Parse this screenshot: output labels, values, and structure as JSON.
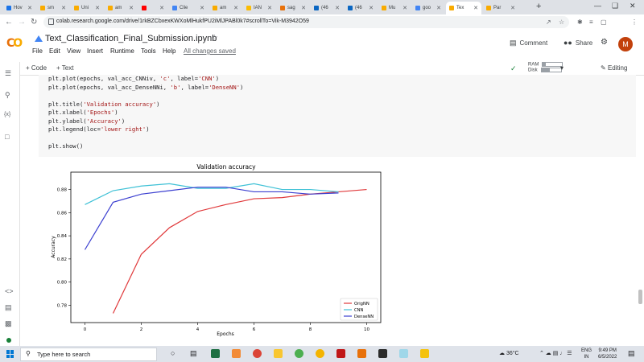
{
  "browser": {
    "tabs": [
      {
        "label": "Hov",
        "color": "#1a73e8"
      },
      {
        "label": "sm",
        "color": "#f9ab00"
      },
      {
        "label": "Uni",
        "color": "#f9ab00"
      },
      {
        "label": "am",
        "color": "#f9ab00"
      },
      {
        "label": "",
        "color": "#ff0000"
      },
      {
        "label": "Clie",
        "color": "#4285f4"
      },
      {
        "label": "am",
        "color": "#f9ab00"
      },
      {
        "label": "IAN",
        "color": "#fbbc04"
      },
      {
        "label": "sag",
        "color": "#e8710a"
      },
      {
        "label": "(46",
        "color": "#0a66c2"
      },
      {
        "label": "(46",
        "color": "#0a66c2"
      },
      {
        "label": "Mu",
        "color": "#f9ab00"
      },
      {
        "label": "goo",
        "color": "#4285f4"
      },
      {
        "label": "Tex",
        "color": "#f9ab00"
      },
      {
        "label": "Par",
        "color": "#f9ab00"
      }
    ],
    "url": "colab.research.google.com/drive/1rkBZCbxexKWXoMlHukfPU2iMlJPABl0k7#scrollTo=Vik-M3942O59"
  },
  "colab": {
    "logo": "CO",
    "title": "Text_Classification_Final_Submission.ipynb",
    "menus": [
      "File",
      "Edit",
      "View",
      "Insert",
      "Runtime",
      "Tools",
      "Help"
    ],
    "saved_status": "All changes saved",
    "comment_label": "Comment",
    "share_label": "Share",
    "avatar_letter": "M",
    "add_code": "+ Code",
    "add_text": "+ Text",
    "ram_label": "RAM",
    "disk_label": "Disk",
    "ram_usage": 0.15,
    "disk_usage": 0.45,
    "editing_label": "Editing"
  },
  "code_lines": [
    "plt.plot(epochs, val_acc_CNNiv, 'c', label='CNN')",
    "plt.plot(epochs, val_acc_DenseNNi, 'b', label='DenseNN')",
    "",
    "plt.title('Validation accuracy')",
    "plt.xlabel('Epochs')",
    "plt.ylabel('Accuracy')",
    "plt.legend(loc='lower right')",
    "",
    "plt.show()"
  ],
  "chart_data": {
    "type": "line",
    "title": "Validation accuracy",
    "xlabel": "Epochs",
    "ylabel": "Accuracy",
    "xlim": [
      -0.5,
      10.5
    ],
    "ylim": [
      0.765,
      0.895
    ],
    "xticks": [
      "0",
      "2",
      "4",
      "6",
      "8",
      "10"
    ],
    "xtick_values": [
      0,
      2,
      4,
      6,
      8,
      10
    ],
    "yticks": [
      "0.78",
      "0.80",
      "0.82",
      "0.84",
      "0.86",
      "0.88"
    ],
    "ytick_values": [
      0.78,
      0.8,
      0.82,
      0.84,
      0.86,
      0.88
    ],
    "legend_loc": "lower right",
    "grid": false,
    "series": [
      {
        "name": "OrigNN",
        "color": "#e0393b",
        "x": [
          1,
          2,
          3,
          4,
          5,
          6,
          7,
          8,
          9,
          10
        ],
        "y": [
          0.773,
          0.824,
          0.847,
          0.861,
          0.867,
          0.872,
          0.873,
          0.876,
          0.878,
          0.88
        ]
      },
      {
        "name": "CNN",
        "color": "#3fc1d6",
        "x": [
          0,
          1,
          2,
          3,
          4,
          5,
          6,
          7,
          8,
          9
        ],
        "y": [
          0.867,
          0.879,
          0.883,
          0.885,
          0.881,
          0.881,
          0.885,
          0.88,
          0.88,
          0.878
        ]
      },
      {
        "name": "DenseNN",
        "color": "#3b3fd0",
        "x": [
          0,
          1,
          2,
          3,
          4,
          5,
          6,
          7,
          8,
          9
        ],
        "y": [
          0.828,
          0.869,
          0.876,
          0.879,
          0.882,
          0.882,
          0.878,
          0.878,
          0.876,
          0.877
        ]
      }
    ]
  },
  "taskbar": {
    "search_placeholder": "Type here to search",
    "weather": "36°C",
    "lang_1": "ENG",
    "lang_2": "IN",
    "time": "9:49 PM",
    "date": "6/5/2022"
  }
}
